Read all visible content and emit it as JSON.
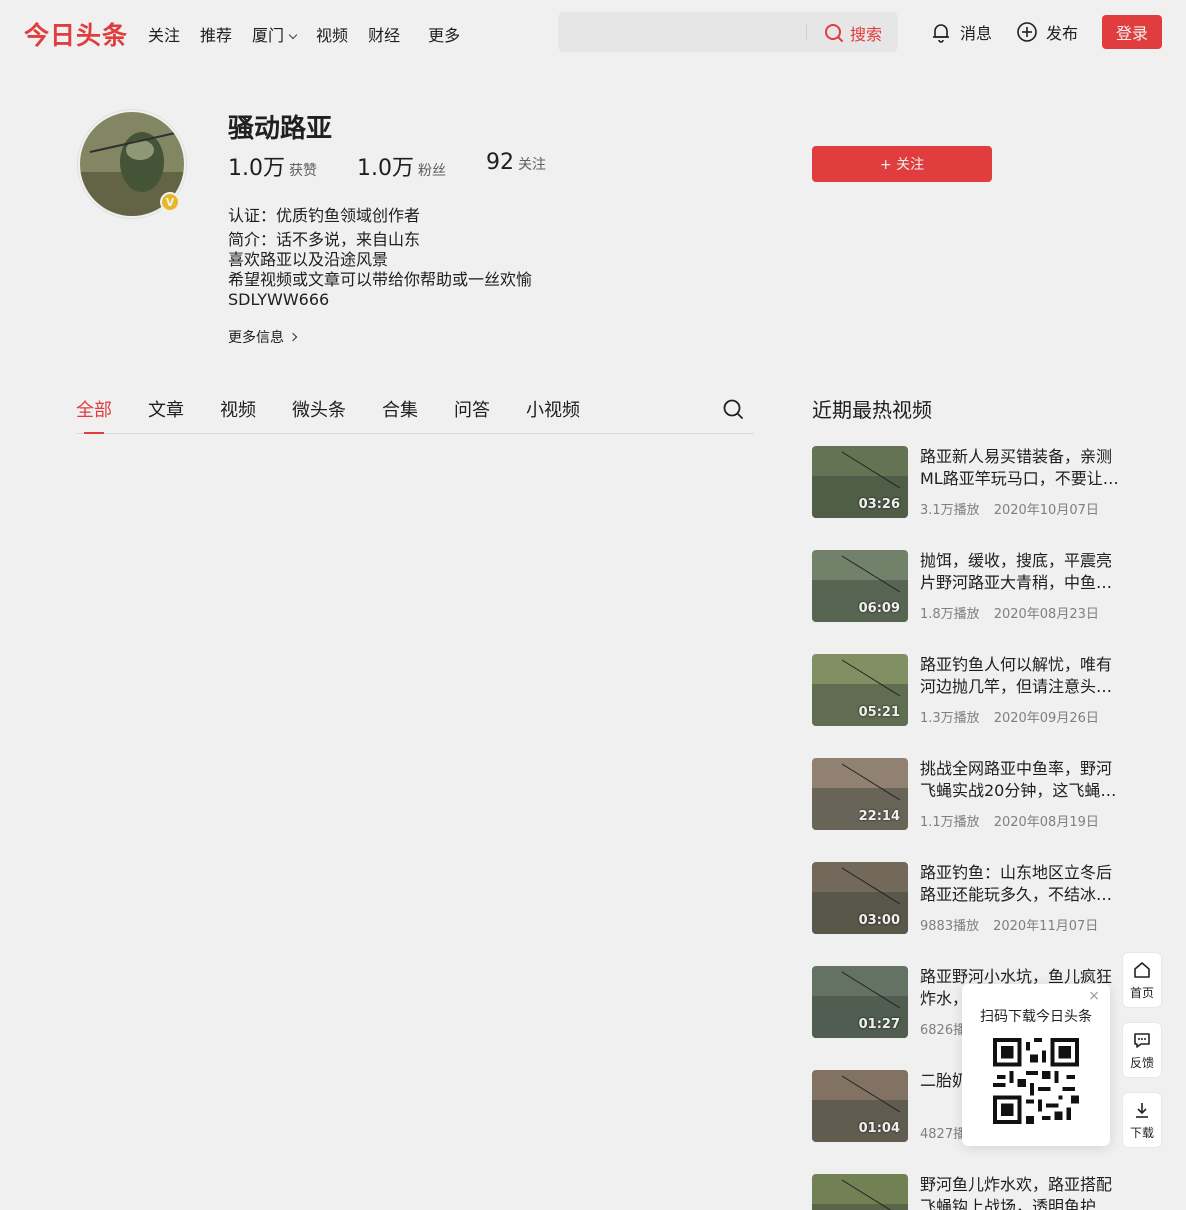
{
  "header": {
    "logo": "今日头条",
    "nav": [
      "关注",
      "推荐",
      "厦门",
      "视频",
      "财经",
      "更多"
    ],
    "search_placeholder": "",
    "search_button": "搜索",
    "messages": "消息",
    "publish": "发布",
    "login": "登录"
  },
  "profile": {
    "name": "骚动路亚",
    "verified_badge": "V",
    "stats": [
      {
        "num": "1.0万",
        "label": "获赞"
      },
      {
        "num": "1.0万",
        "label": "粉丝"
      },
      {
        "num": "92",
        "label": "关注"
      }
    ],
    "certification": "认证：优质钓鱼领域创作者",
    "bio_lines": [
      "简介：话不多说，来自山东",
      "喜欢路亚以及沿途风景",
      "希望视频或文章可以带给你帮助或一丝欢愉",
      "SDLYWW666"
    ],
    "more_info": "更多信息",
    "follow_button": "+ 关注"
  },
  "tabs": [
    "全部",
    "文章",
    "视频",
    "微头条",
    "合集",
    "问答",
    "小视频"
  ],
  "hot_videos": {
    "title": "近期最热视频",
    "items": [
      {
        "title": "路亚新人易买错装备，亲测ML路亚竿玩马口，不要让…",
        "duration": "03:26",
        "plays": "3.1万播放",
        "date": "2020年10月07日",
        "color": "#6b7b5a"
      },
      {
        "title": "抛饵，缓收，搜底，平震亮片野河路亚大青稍，中鱼…",
        "duration": "06:09",
        "plays": "1.8万播放",
        "date": "2020年08月23日",
        "color": "#7a8a70"
      },
      {
        "title": "路亚钓鱼人何以解忧，唯有河边抛几竿，但请注意头…",
        "duration": "05:21",
        "plays": "1.3万播放",
        "date": "2020年09月26日",
        "color": "#8a9a6a"
      },
      {
        "title": "挑战全网路亚中鱼率，野河飞蝇实战20分钟，这飞蝇…",
        "duration": "22:14",
        "plays": "1.1万播放",
        "date": "2020年08月19日",
        "color": "#9a8a7a"
      },
      {
        "title": "路亚钓鱼：山东地区立冬后路亚还能玩多久，不结冰…",
        "duration": "03:00",
        "plays": "9883播放",
        "date": "2020年11月07日",
        "color": "#7a7060"
      },
      {
        "title": "路亚野河小水坑，鱼儿疯狂炸水，",
        "duration": "01:27",
        "plays": "6826播放",
        "date": "",
        "color": "#6a7a6a"
      },
      {
        "title": "二胎奶爸网断货",
        "duration": "01:04",
        "plays": "4827播放",
        "date": "",
        "color": "#8a7a6a"
      },
      {
        "title": "野河鱼儿炸水欢，路亚搭配飞蝇钩上战场，透明鱼护",
        "duration": "",
        "plays": "",
        "date": "",
        "color": "#7a8a5a"
      }
    ]
  },
  "side_tools": [
    "首页",
    "反馈",
    "下载"
  ],
  "qr_popup": {
    "title": "扫码下载今日头条",
    "close": "×"
  }
}
